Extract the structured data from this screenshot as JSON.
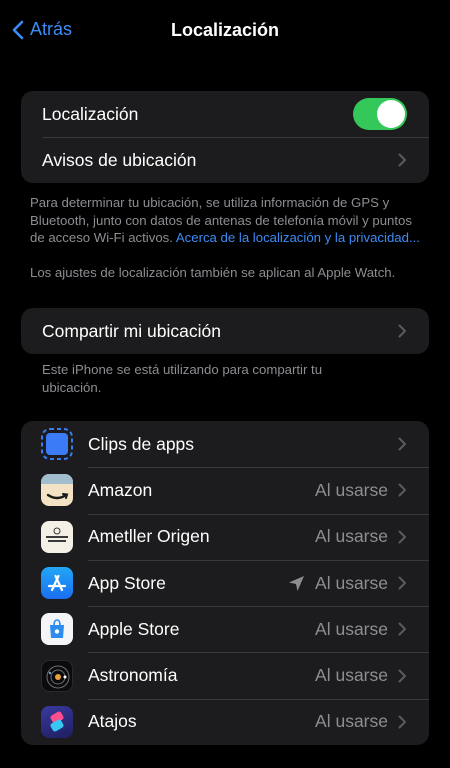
{
  "nav": {
    "back_label": "Atrás",
    "title": "Localización"
  },
  "location_group": {
    "toggle_label": "Localización",
    "toggle_on": true,
    "alerts_label": "Avisos de ubicación"
  },
  "footnote1": {
    "text": "Para determinar tu ubicación, se utiliza información de GPS y Bluetooth, junto con datos de antenas de telefonía móvil y puntos de acceso Wi-Fi activos. ",
    "link": "Acerca de la localización y la privacidad..."
  },
  "footnote2": "Los ajustes de localización también se aplican al Apple Watch.",
  "share_group": {
    "label": "Compartir mi ubicación"
  },
  "footnote3": "Este iPhone se está utilizando para compartir tu ubicación.",
  "apps": [
    {
      "name": "Clips de apps",
      "status": "",
      "icon": "app-clips-icon"
    },
    {
      "name": "Amazon",
      "status": "Al usarse",
      "icon": "amazon-icon"
    },
    {
      "name": "Ametller Origen",
      "status": "Al usarse",
      "icon": "ametller-origen-icon"
    },
    {
      "name": "App Store",
      "status": "Al usarse",
      "icon": "app-store-icon",
      "recent_location": true
    },
    {
      "name": "Apple Store",
      "status": "Al usarse",
      "icon": "apple-store-icon"
    },
    {
      "name": "Astronomía",
      "status": "Al usarse",
      "icon": "astronomy-icon"
    },
    {
      "name": "Atajos",
      "status": "Al usarse",
      "icon": "shortcuts-icon"
    }
  ],
  "colors": {
    "accent": "#3b8cf6",
    "toggle_on": "#34c759",
    "group_bg": "#1c1c1e",
    "secondary_text": "#8d8d93"
  }
}
